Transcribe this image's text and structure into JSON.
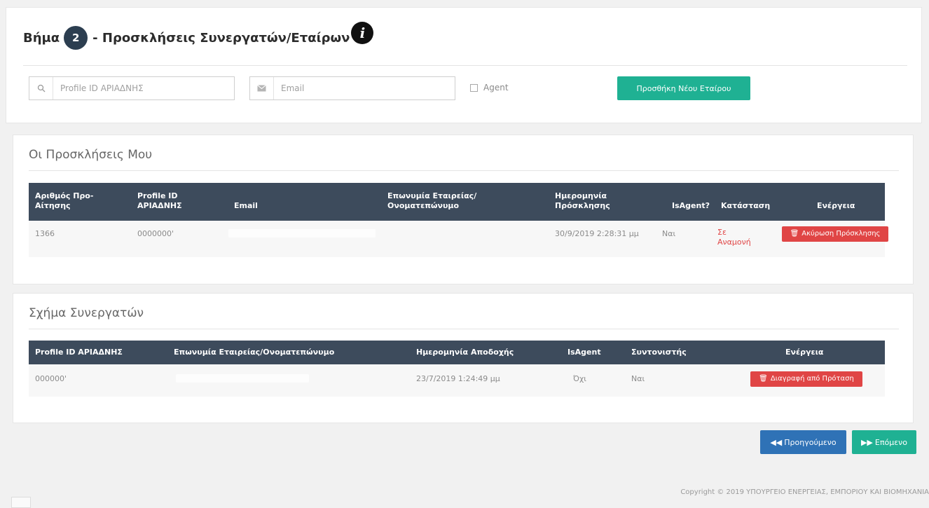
{
  "step": {
    "label": "Βήμα",
    "number": "2",
    "title": "- Προσκλήσεις Συνεργατών/Εταίρων",
    "info_icon": "i"
  },
  "search": {
    "profile_placeholder": "Profile ID ΑΡΙΑΔΝΗΣ",
    "email_placeholder": "Email",
    "agent_label": "Agent",
    "add_button": "Προσθήκη Νέου Εταίρου"
  },
  "invites": {
    "title": "Οι Προσκλήσεις Μου",
    "headers": {
      "id_l1": "Αριθμός Προ-",
      "id_l2": "Αίτησης",
      "profile_l1": "Profile ID",
      "profile_l2": "ΑΡΙΑΔΝΗΣ",
      "email": "Email",
      "name_l1": "Επωνυμία Εταιρείας/",
      "name_l2": "Ονοματεπώνυμο",
      "date_l1": "Ημερομηνία",
      "date_l2": "Πρόσκλησης",
      "isagent": "IsAgent?",
      "status": "Κατάσταση",
      "action": "Ενέργεια"
    },
    "row": {
      "id": "1366",
      "profile": "0000000'",
      "date": "30/9/2019 2:28:31 μμ",
      "isagent": "Ναι",
      "status_l1": "Σε",
      "status_l2": "Αναμονή",
      "action": "Ακύρωση Πρόσκλησης"
    }
  },
  "partners": {
    "title": "Σχήμα Συνεργατών",
    "headers": {
      "profile": "Profile ID ΑΡΙΑΔΝΗΣ",
      "name": "Επωνυμία Εταιρείας/Ονοματεπώνυμο",
      "date": "Ημερομηνία Αποδοχής",
      "isagent": "IsAgent",
      "coordinator": "Συντονιστής",
      "action": "Ενέργεια"
    },
    "row": {
      "profile": "000000'",
      "date": "23/7/2019 1:24:49 μμ",
      "isagent": "Όχι",
      "coordinator": "Ναι",
      "action": "Διαγραφή από Πρόταση"
    }
  },
  "nav": {
    "prev": "Προηγούμενο",
    "next": "Επόμενο"
  },
  "footer": {
    "copyright": "Copyright © 2019 ΥΠΟΥΡΓΕΙΟ ΕΝΕΡΓΕΙΑΣ, ΕΜΠΟΡΙΟΥ ΚΑΙ ΒΙΟΜΗΧΑΝΙΑ"
  }
}
